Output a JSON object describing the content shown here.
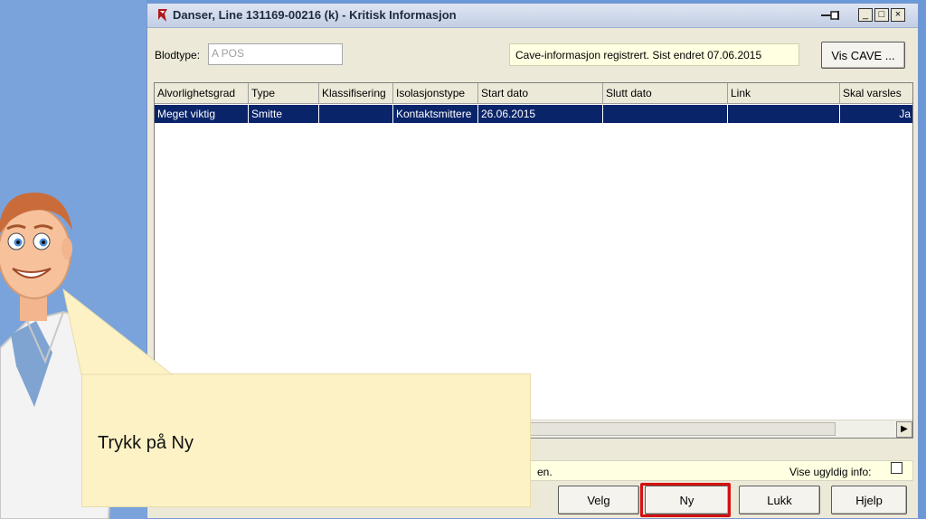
{
  "window": {
    "title": "Danser, Line  131169-00216 (k) - Kritisk Informasjon",
    "minimize": "_",
    "maximize": "□",
    "close": "×"
  },
  "bloodtype": {
    "label": "Blodtype:",
    "value": "A POS"
  },
  "cave": {
    "info": "Cave-informasjon registrert. Sist endret 07.06.2015",
    "button": "Vis CAVE ..."
  },
  "table": {
    "headers": [
      "Alvorlighetsgrad",
      "Type",
      "Klassifisering",
      "Isolasjonstype",
      "Start dato",
      "Slutt dato",
      "Link",
      "Skal varsles"
    ],
    "rows": [
      [
        "Meget viktig",
        "Smitte",
        "",
        "Kontaktsmittere",
        "26.06.2015",
        "",
        "",
        "Ja"
      ]
    ]
  },
  "status": {
    "text": "en.",
    "invalid_label": "Vise ugyldig info:"
  },
  "buttons": {
    "velg": "Velg",
    "ny": "Ny",
    "lukk": "Lukk",
    "hjelp": "Hjelp"
  },
  "callout": {
    "text": "Trykk på Ny"
  },
  "colors": {
    "highlight": "#d41010",
    "selection": "#0a246a",
    "callout": "#fdf2c6"
  }
}
